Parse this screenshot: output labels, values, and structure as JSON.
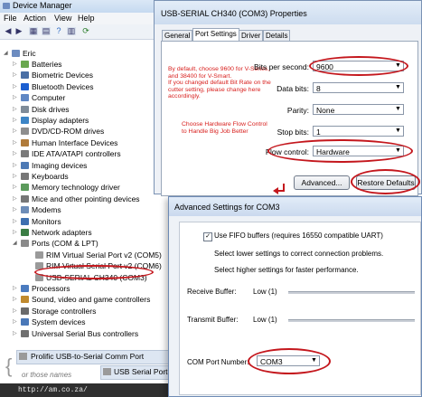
{
  "device_manager": {
    "title": "Device Manager",
    "menu": [
      "File",
      "Action",
      "View",
      "Help"
    ],
    "root": "Eric",
    "tree": [
      {
        "label": "Batteries",
        "color": "#6aa84f"
      },
      {
        "label": "Biometric Devices",
        "color": "#4a6fa5"
      },
      {
        "label": "Bluetooth Devices",
        "color": "#1c5fd1"
      },
      {
        "label": "Computer",
        "color": "#5f87c4"
      },
      {
        "label": "Disk drives",
        "color": "#7f8c99"
      },
      {
        "label": "Display adapters",
        "color": "#3d85c6"
      },
      {
        "label": "DVD/CD-ROM drives",
        "color": "#8e8e8e"
      },
      {
        "label": "Human Interface Devices",
        "color": "#b07b3a"
      },
      {
        "label": "IDE ATA/ATAPI controllers",
        "color": "#7a7a7a"
      },
      {
        "label": "Imaging devices",
        "color": "#4e7ab5"
      },
      {
        "label": "Keyboards",
        "color": "#777"
      },
      {
        "label": "Memory technology driver",
        "color": "#5c9b5c"
      },
      {
        "label": "Mice and other pointing devices",
        "color": "#777"
      },
      {
        "label": "Modems",
        "color": "#6d8db8"
      },
      {
        "label": "Monitors",
        "color": "#3d6fb0"
      },
      {
        "label": "Network adapters",
        "color": "#3a7d44"
      },
      {
        "label": "Ports (COM & LPT)",
        "color": "#8a8a8a"
      },
      {
        "label": "RIM Virtual Serial Port v2 (COM5)",
        "color": "#9a9a9a"
      },
      {
        "label": "RIM Virtual Serial Port v2 (COM6)",
        "color": "#9a9a9a"
      },
      {
        "label": "USB-SERIAL CH340 (COM3)",
        "color": "#9a9a9a"
      },
      {
        "label": "Processors",
        "color": "#4b7bbf"
      },
      {
        "label": "Sound, video and game controllers",
        "color": "#c08a2e"
      },
      {
        "label": "Storage controllers",
        "color": "#6b6b6b"
      },
      {
        "label": "System devices",
        "color": "#4a78b8"
      },
      {
        "label": "Universal Serial Bus controllers",
        "color": "#6f6f6f"
      }
    ],
    "alt_name_1": "Prolific USB-to-Serial Comm Port",
    "alt_name_2": "USB Serial Port",
    "or_those_names": "or those names",
    "url": "http://am.co.za/"
  },
  "properties": {
    "title": "USB-SERIAL CH340 (COM3) Properties",
    "tabs": [
      "General",
      "Port Settings",
      "Driver",
      "Details"
    ],
    "bits_per_second_label": "Bits per second:",
    "bits_per_second": "9600",
    "data_bits_label": "Data bits:",
    "data_bits": "8",
    "parity_label": "Parity:",
    "parity": "None",
    "stop_bits_label": "Stop bits:",
    "stop_bits": "1",
    "flow_control_label": "Flow control:",
    "flow_control": "Hardware",
    "advanced_button": "Advanced...",
    "restore_button": "Restore Defaults",
    "note_baud": [
      "By default, choose 9600 for V-Series,",
      "and 38400 for V-Smart.",
      "If you changed default Bit Rate on the",
      "cutter setting, please change here",
      "accordingly."
    ],
    "note_flow": [
      "Choose Hardware Flow Control",
      "to Handle Big Job Better"
    ]
  },
  "advanced": {
    "title": "Advanced Settings for COM3",
    "use_fifo_label": "Use FIFO buffers (requires 16550 compatible UART)",
    "use_fifo_checked": true,
    "hint_lower": "Select lower settings to correct connection problems.",
    "hint_higher": "Select higher settings for faster performance.",
    "receive_label": "Receive Buffer:",
    "receive_value": "Low (1)",
    "transmit_label": "Transmit Buffer:",
    "transmit_value": "Low (1)",
    "com_port_label": "COM Port Number:",
    "com_port_value": "COM3"
  }
}
